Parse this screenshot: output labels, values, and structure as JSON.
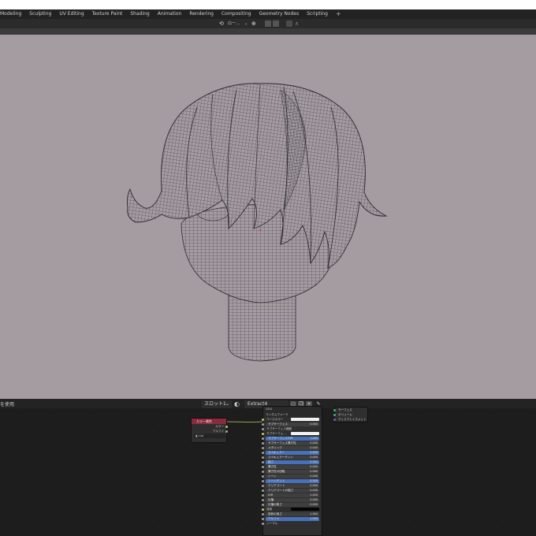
{
  "menu": {
    "tabs": [
      "Modeling",
      "Sculpting",
      "UV Editing",
      "Texture Paint",
      "Shading",
      "Animation",
      "Rendering",
      "Compositing",
      "Geometry Nodes",
      "Scripting"
    ],
    "add_label": "+"
  },
  "viewport_header": {
    "transform_label": "ロー…"
  },
  "node_editor": {
    "left_label": "を使用",
    "slot": "スロット1",
    "material_name": "Extract4",
    "color_attr_node": {
      "title": "カラー属性",
      "outputs": [
        "カラー",
        "アルファ"
      ],
      "dropdown": "Col"
    },
    "bsdf_node": {
      "title": "GGX",
      "subsurface_method": "ランダムウォーク",
      "rows": [
        {
          "label": "ベースカラー",
          "value": "",
          "blue": false
        },
        {
          "label": "サブサーフェス",
          "value": "0.000",
          "blue": false
        },
        {
          "label": "サブサーフェス範囲",
          "value": "",
          "blue": false
        },
        {
          "label": "サブサーフェ…",
          "value": "",
          "blue": false
        },
        {
          "label": "サブサーフェスIOR",
          "value": "1.400",
          "blue": true
        },
        {
          "label": "サブサーフェス異方性",
          "value": "0.000",
          "blue": false
        },
        {
          "label": "メタリック",
          "value": "0.000",
          "blue": false
        },
        {
          "label": "スペキュラー",
          "value": "0.500",
          "blue": true
        },
        {
          "label": "スペキュラーチント",
          "value": "0.000",
          "blue": false
        },
        {
          "label": "粗さ",
          "value": "0.500",
          "blue": true
        },
        {
          "label": "異方性",
          "value": "0.000",
          "blue": false
        },
        {
          "label": "異方性の回転",
          "value": "0.000",
          "blue": false
        },
        {
          "label": "シーン",
          "value": "0.000",
          "blue": false
        },
        {
          "label": "シーンチント",
          "value": "0.500",
          "blue": true
        },
        {
          "label": "クリアコート",
          "value": "0.000",
          "blue": false
        },
        {
          "label": "クリアコートの粗さ",
          "value": "0.030",
          "blue": false
        },
        {
          "label": "IOR",
          "value": "1.450",
          "blue": false
        },
        {
          "label": "伝播",
          "value": "0.000",
          "blue": false
        },
        {
          "label": "伝播の粗さ",
          "value": "0.000",
          "blue": false
        },
        {
          "label": "放射",
          "value": "",
          "blue": false
        },
        {
          "label": "放射の強さ",
          "value": "1.000",
          "blue": false
        },
        {
          "label": "アルファ",
          "value": "1.000",
          "blue": true
        },
        {
          "label": "ノーマル",
          "value": "",
          "blue": false
        }
      ]
    },
    "output_node": {
      "rows": [
        "サーフェス",
        "ボリューム",
        "ディスプレイスメント"
      ]
    }
  },
  "colors": {
    "viewport_bg": "#a59ca2",
    "wire": "#2a2a2e",
    "node_editor_bg": "#1d1d1d",
    "node_header_red": "#8a2a3a",
    "node_header_green": "#1f5a40",
    "value_blue": "#4770b8"
  }
}
